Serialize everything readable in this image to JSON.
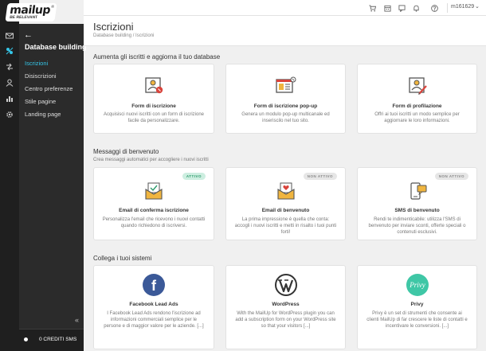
{
  "app": {
    "logo_text": "mailup",
    "logo_tagline": "BE RELEVANT",
    "logo_reg": "®"
  },
  "topbar": {
    "username": "m161629"
  },
  "sidebar": {
    "back_label": "←",
    "title": "Database building",
    "items": [
      {
        "label": "Iscrizioni",
        "active": true
      },
      {
        "label": "Disiscrizioni",
        "active": false
      },
      {
        "label": "Centro preferenze",
        "active": false
      },
      {
        "label": "Stile pagine",
        "active": false
      },
      {
        "label": "Landing page",
        "active": false
      }
    ],
    "collapse_label": "«",
    "credits_label": "0 CREDITI SMS"
  },
  "page": {
    "title": "Iscrizioni",
    "breadcrumb": "Database building / Iscrizioni"
  },
  "sections": [
    {
      "title": "Aumenta gli iscritti e aggiorna il tuo database",
      "subtitle": "",
      "cards": [
        {
          "icon": "subscription-form-icon",
          "title": "Form di iscrizione",
          "desc": "Acquisisci nuovi iscritti con un form di iscrizione facile da personalizzare.",
          "badge": ""
        },
        {
          "icon": "popup-form-icon",
          "title": "Form di iscrizione pop-up",
          "desc": "Genera un modulo pop-up multicanale ed inseriscilo nel tuo sito.",
          "badge": ""
        },
        {
          "icon": "profiling-form-icon",
          "title": "Form di profilazione",
          "desc": "Offri ai tuoi iscritti un modo semplice per aggiornare le loro informazioni.",
          "badge": ""
        }
      ]
    },
    {
      "title": "Messaggi di benvenuto",
      "subtitle": "Crea messaggi automatici per accogliere i nuovi iscritti",
      "cards": [
        {
          "icon": "confirmation-email-icon",
          "title": "Email di conferma iscrizione",
          "desc": "Personalizza l'email che ricevono i nuovi contatti quando richiedono di iscriversi.",
          "badge": "ATTIVO"
        },
        {
          "icon": "welcome-email-icon",
          "title": "Email di benvenuto",
          "desc": "La prima impressione è quella che conta: accogli i nuovi iscritti e metti in risalto i tuoi punti forti!",
          "badge": "NON ATTIVO"
        },
        {
          "icon": "welcome-sms-icon",
          "title": "SMS di benvenuto",
          "desc": "Rendi te indimenticabile: utilizza l'SMS di benvenuto per inviare sconti, offerte speciali o contenuti esclusivi.",
          "badge": "NON ATTIVO"
        }
      ]
    },
    {
      "title": "Collega i tuoi sistemi",
      "subtitle": "",
      "cards": [
        {
          "icon": "facebook-icon",
          "title": "Facebook Lead Ads",
          "desc": "I Facebook Lead Ads rendono l'iscrizione ad informazioni commerciali semplice per le persone e di maggior valore per le aziende. [...]",
          "badge": ""
        },
        {
          "icon": "wordpress-icon",
          "title": "WordPress",
          "desc": "With the MailUp for WordPress plugin you can add a subscription form on your WordPress site so that your visitors [...]",
          "badge": ""
        },
        {
          "icon": "privy-icon",
          "title": "Privy",
          "desc": "Privy è un set di strumenti che consente ai clienti MailUp di far crescere le liste di contatti e incentivare le conversioni. [...]",
          "badge": ""
        }
      ]
    }
  ],
  "icons": {
    "privy_text": "Privy",
    "facebook_text": "f"
  },
  "colors": {
    "accent": "#35c6e8",
    "active_badge_bg": "#cdeee0",
    "active_badge_text": "#2c9b6c",
    "inactive_badge_bg": "#e6e6e6",
    "facebook": "#3b5998",
    "privy": "#3fc7a6",
    "icon_orange": "#f0b53f",
    "icon_red": "#d9433b"
  }
}
